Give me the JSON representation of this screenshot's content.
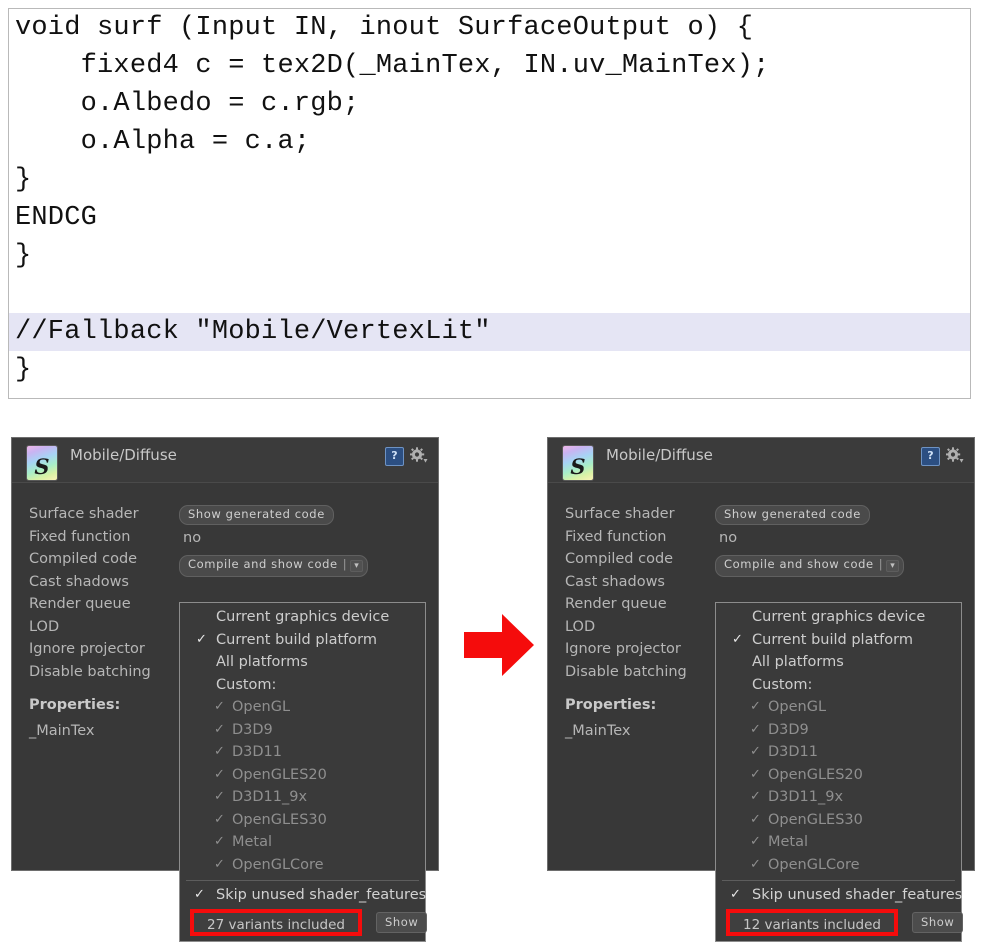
{
  "code": {
    "lines": [
      {
        "text": "void surf (Input IN, inout SurfaceOutput o) {",
        "highlight": false
      },
      {
        "text": "    fixed4 c = tex2D(_MainTex, IN.uv_MainTex);",
        "highlight": false
      },
      {
        "text": "    o.Albedo = c.rgb;",
        "highlight": false
      },
      {
        "text": "    o.Alpha = c.a;",
        "highlight": false
      },
      {
        "text": "}",
        "highlight": false
      },
      {
        "text": "ENDCG",
        "highlight": false
      },
      {
        "text": "}",
        "highlight": false
      },
      {
        "text": " ",
        "highlight": false
      },
      {
        "text": "//Fallback \"Mobile/VertexLit\"",
        "highlight": true
      },
      {
        "text": "}",
        "highlight": false
      }
    ],
    "highlight_color": "#e5e5f4"
  },
  "arrow": {
    "name": "red-right-arrow",
    "color": "#f50c0c"
  },
  "panels": [
    {
      "id": "left",
      "header": {
        "title": "Mobile/Diffuse",
        "icon_glyph": "S",
        "help_glyph": "?",
        "gear_name": "gear-icon"
      },
      "labels": [
        "Surface shader",
        "Fixed function",
        "Compiled code",
        "Cast shadows",
        "Render queue",
        "LOD",
        "Ignore projector",
        "Disable batching"
      ],
      "properties_header": "Properties:",
      "properties": [
        "_MainTex"
      ],
      "fields": {
        "surface_shader_button": "Show generated code",
        "fixed_function_value": "no",
        "compiled_code_button": "Compile and show code",
        "compiled_code_separator": "|",
        "compiled_code_caret": "▾"
      },
      "dropdown": {
        "items": [
          {
            "label": "Current graphics device",
            "checked": false,
            "sub": false
          },
          {
            "label": "Current build platform",
            "checked": true,
            "sub": false
          },
          {
            "label": "All platforms",
            "checked": false,
            "sub": false
          },
          {
            "label": "Custom:",
            "checked": false,
            "sub": false
          },
          {
            "label": "OpenGL",
            "checked": true,
            "sub": true
          },
          {
            "label": "D3D9",
            "checked": true,
            "sub": true
          },
          {
            "label": "D3D11",
            "checked": true,
            "sub": true
          },
          {
            "label": "OpenGLES20",
            "checked": true,
            "sub": true
          },
          {
            "label": "D3D11_9x",
            "checked": true,
            "sub": true
          },
          {
            "label": "OpenGLES30",
            "checked": true,
            "sub": true
          },
          {
            "label": "Metal",
            "checked": true,
            "sub": true
          },
          {
            "label": "OpenGLCore",
            "checked": true,
            "sub": true
          }
        ],
        "skip_option": {
          "label": "Skip unused shader_features",
          "checked": true
        },
        "variants_text": "27 variants included",
        "show_button": "Show",
        "highlight_color": "#f50c0c"
      }
    },
    {
      "id": "right",
      "header": {
        "title": "Mobile/Diffuse",
        "icon_glyph": "S",
        "help_glyph": "?",
        "gear_name": "gear-icon"
      },
      "labels": [
        "Surface shader",
        "Fixed function",
        "Compiled code",
        "Cast shadows",
        "Render queue",
        "LOD",
        "Ignore projector",
        "Disable batching"
      ],
      "properties_header": "Properties:",
      "properties": [
        "_MainTex"
      ],
      "fields": {
        "surface_shader_button": "Show generated code",
        "fixed_function_value": "no",
        "compiled_code_button": "Compile and show code",
        "compiled_code_separator": "|",
        "compiled_code_caret": "▾"
      },
      "dropdown": {
        "items": [
          {
            "label": "Current graphics device",
            "checked": false,
            "sub": false
          },
          {
            "label": "Current build platform",
            "checked": true,
            "sub": false
          },
          {
            "label": "All platforms",
            "checked": false,
            "sub": false
          },
          {
            "label": "Custom:",
            "checked": false,
            "sub": false
          },
          {
            "label": "OpenGL",
            "checked": true,
            "sub": true
          },
          {
            "label": "D3D9",
            "checked": true,
            "sub": true
          },
          {
            "label": "D3D11",
            "checked": true,
            "sub": true
          },
          {
            "label": "OpenGLES20",
            "checked": true,
            "sub": true
          },
          {
            "label": "D3D11_9x",
            "checked": true,
            "sub": true
          },
          {
            "label": "OpenGLES30",
            "checked": true,
            "sub": true
          },
          {
            "label": "Metal",
            "checked": true,
            "sub": true
          },
          {
            "label": "OpenGLCore",
            "checked": true,
            "sub": true
          }
        ],
        "skip_option": {
          "label": "Skip unused shader_features",
          "checked": true
        },
        "variants_text": "12 variants included",
        "show_button": "Show",
        "highlight_color": "#f50c0c"
      }
    }
  ]
}
